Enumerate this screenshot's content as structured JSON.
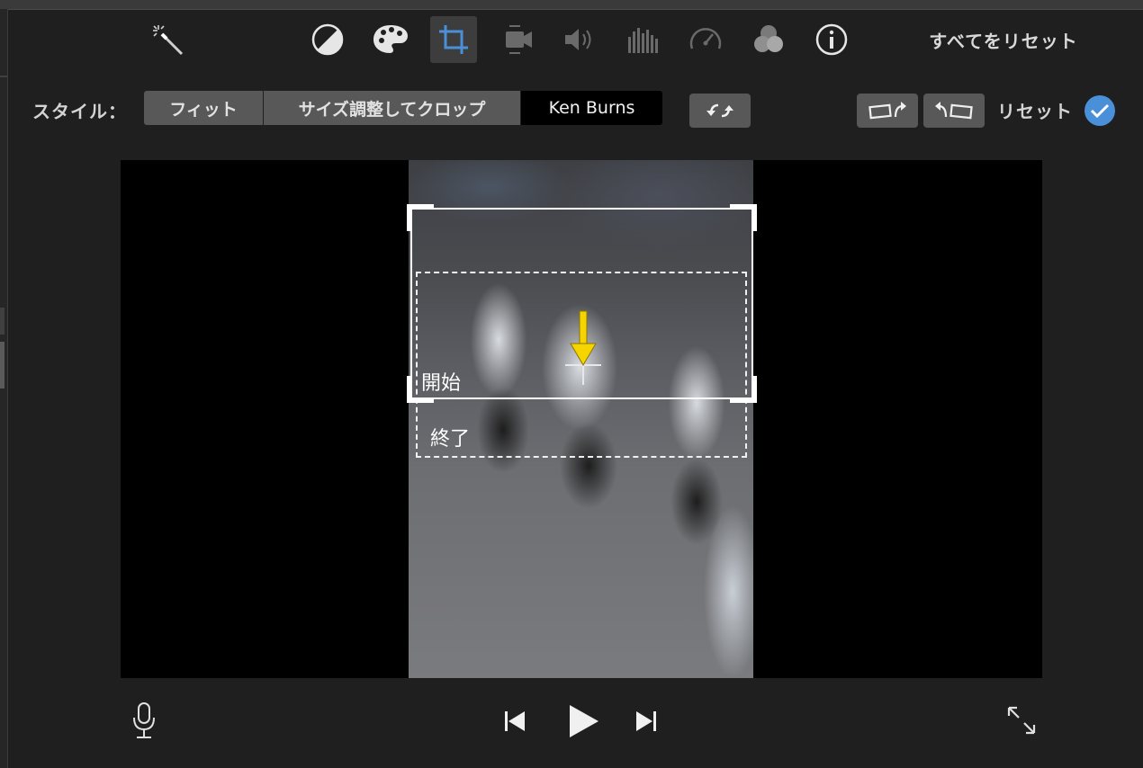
{
  "toolbar": {
    "tools": [
      {
        "icon": "magic-wand-icon",
        "active": false
      },
      {
        "icon": "color-balance-icon",
        "active": false
      },
      {
        "icon": "color-palette-icon",
        "active": false
      },
      {
        "icon": "crop-icon",
        "active": true
      },
      {
        "icon": "stabilization-camera-icon",
        "active": false
      },
      {
        "icon": "volume-icon",
        "active": false
      },
      {
        "icon": "equalizer-icon",
        "active": false
      },
      {
        "icon": "speed-gauge-icon",
        "active": false
      },
      {
        "icon": "clip-filter-icon",
        "active": false
      },
      {
        "icon": "info-icon",
        "active": false
      }
    ],
    "reset_all_label": "すべてをリセット"
  },
  "crop_panel": {
    "style_label": "スタイル：",
    "styles": [
      "フィット",
      "サイズ調整してクロップ",
      "Ken Burns"
    ],
    "selected_style": "Ken Burns",
    "swap_icon": "swap-start-end-icon",
    "rotate_left_icon": "rotate-left-icon",
    "rotate_right_icon": "rotate-right-icon",
    "reset_label": "リセット",
    "apply_icon": "checkmark-icon",
    "accent_color": "#4a90d9"
  },
  "viewer": {
    "start_label": "開始",
    "end_label": "終了",
    "direction_arrow_color": "#f5d400"
  },
  "playback": {
    "mic_icon": "microphone-icon",
    "prev_icon": "skip-back-icon",
    "play_icon": "play-icon",
    "next_icon": "skip-forward-icon",
    "fullscreen_icon": "fullscreen-icon"
  }
}
